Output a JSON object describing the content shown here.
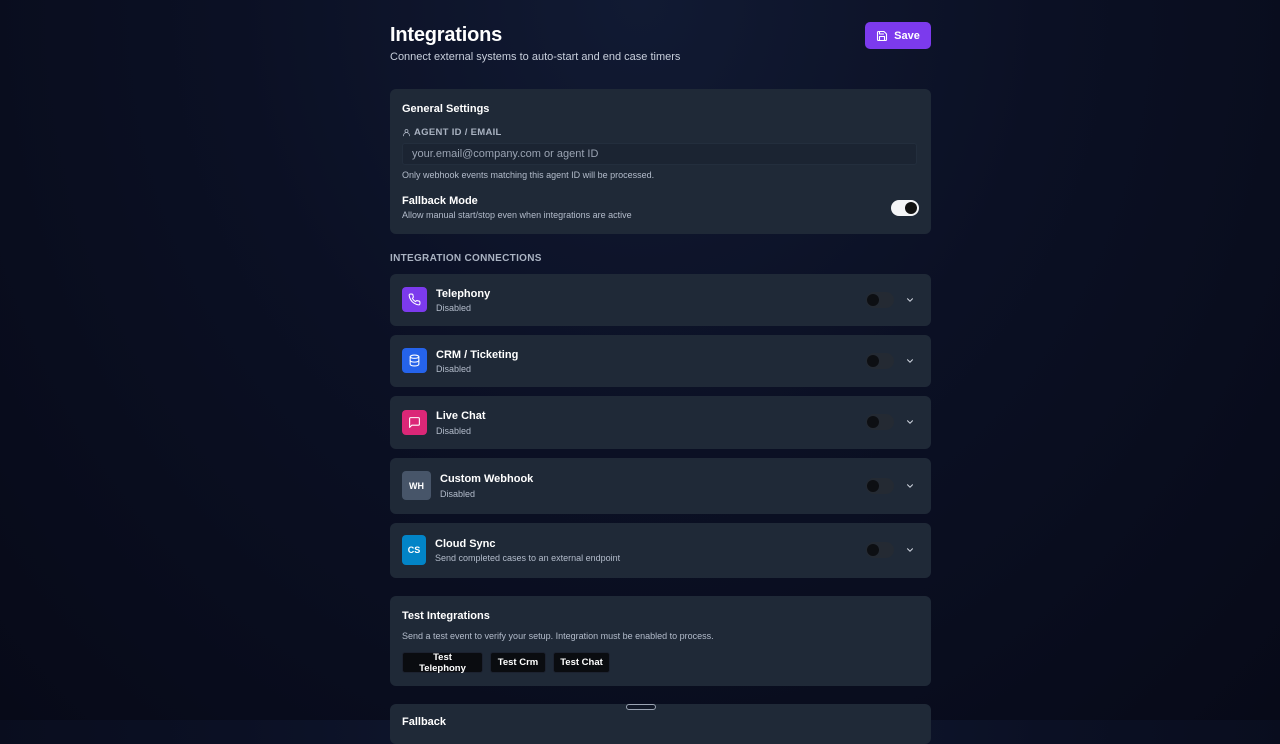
{
  "header": {
    "title": "Integrations",
    "subtitle": "Connect external systems to auto-start and end case timers",
    "save_label": "Save"
  },
  "general": {
    "title": "General Settings",
    "agent_label": "AGENT ID / EMAIL",
    "agent_placeholder": "your.email@company.com or agent ID",
    "agent_value": "",
    "agent_help": "Only webhook events matching this agent ID will be processed.",
    "fallback_title": "Fallback Mode",
    "fallback_desc": "Allow manual start/stop even when integrations are active",
    "fallback_enabled": true
  },
  "connections": {
    "section_label": "INTEGRATION CONNECTIONS",
    "items": [
      {
        "name": "Telephony",
        "status": "Disabled",
        "icon": "phone-icon",
        "color": "#7c3aed",
        "enabled": false
      },
      {
        "name": "CRM / Ticketing",
        "status": "Disabled",
        "icon": "database-icon",
        "color": "#2563eb",
        "enabled": false
      },
      {
        "name": "Live Chat",
        "status": "Disabled",
        "icon": "message-square-icon",
        "color": "#db2777",
        "enabled": false
      },
      {
        "name": "Custom Webhook",
        "status": "Disabled",
        "icon": "WH",
        "color": "#475569",
        "enabled": false
      },
      {
        "name": "Cloud Sync",
        "status": "Send completed cases to an external endpoint",
        "icon": "CS",
        "color": "#0284c7",
        "enabled": false
      }
    ]
  },
  "test": {
    "title": "Test Integrations",
    "desc": "Send a test event to verify your setup. Integration must be enabled to process.",
    "buttons": [
      "Test Telephony",
      "Test Crm",
      "Test Chat"
    ]
  },
  "next_section": {
    "title": "Fallback"
  },
  "colors": {
    "accent": "#7c3aed",
    "card": "#1f2937",
    "background": "#0b1024"
  }
}
